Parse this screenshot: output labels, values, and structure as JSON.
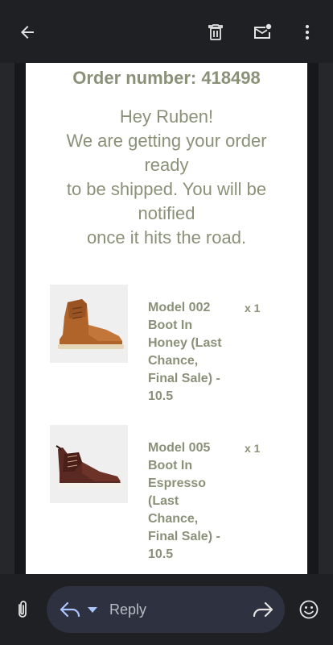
{
  "order": {
    "title": "Order number: 418498",
    "greeting_lines": [
      "Hey Ruben!",
      "We are getting your order",
      "ready",
      "to be shipped. You will be",
      "notified",
      "once it hits the road."
    ]
  },
  "products": [
    {
      "name_lines": [
        "Model 002",
        "Boot In",
        "Honey (Last",
        "Chance,",
        "Final Sale) -",
        "10.5"
      ],
      "quantity": "x 1",
      "image": "honey-boot"
    },
    {
      "name_lines": [
        "Model 005",
        "Boot In",
        "Espresso",
        "(Last",
        "Chance,",
        "Final Sale) -",
        "10.5"
      ],
      "quantity": "x 1",
      "image": "espresso-boot"
    }
  ],
  "reply_bar": {
    "reply_label": "Reply"
  },
  "colors": {
    "accent_text": "#8a9178",
    "card_bg": "#ffffff",
    "bar_bg": "#1f2023",
    "pill_bg": "#2d3140",
    "icon_color": "#e3e3e3"
  },
  "icons": [
    "back-arrow-icon",
    "trash-icon",
    "mark-unread-icon",
    "more-vert-icon",
    "attachment-icon",
    "reply-icon",
    "dropdown-caret-icon",
    "forward-icon",
    "emoji-icon"
  ]
}
